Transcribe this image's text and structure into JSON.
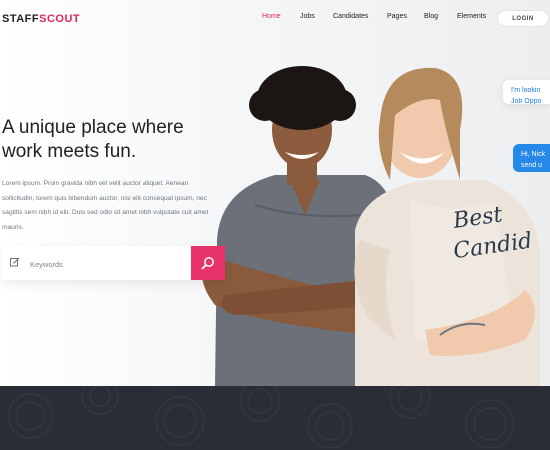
{
  "brand": {
    "name_part1": "STAFF",
    "name_part2": "SCOUT",
    "accent_color": "#e0245e"
  },
  "nav": {
    "items": [
      {
        "label": "Home",
        "active": true
      },
      {
        "label": "Jobs"
      },
      {
        "label": "Candidates"
      },
      {
        "label": "Pages"
      },
      {
        "label": "Blog"
      },
      {
        "label": "Elements"
      }
    ],
    "login_label": "LOGIN"
  },
  "hero": {
    "headline_line1": "A unique place where",
    "headline_line2": "work meets fun.",
    "description": "Lorem ipsum. Proin gravida nibh vel velit auctor aliquet. Aenean sollicitudin, lorem quis bibendum auctor, nisi elit consequat ipsum, nec sagittis sem nibh id elit. Duis sed odio sit amet nibh vulputate cuit amet mauris.",
    "search": {
      "placeholder": "Keywords",
      "button_color": "#e8336a"
    }
  },
  "chat": {
    "bubble1_line1": "I'm lookin",
    "bubble1_line2": "Job Oppo",
    "bubble2_line1": "Hi, Nick",
    "bubble2_line2": "send u"
  },
  "overlay_script": {
    "line1": "Best",
    "line2": "Candid"
  },
  "icons": [
    "edit-icon",
    "search-icon"
  ]
}
